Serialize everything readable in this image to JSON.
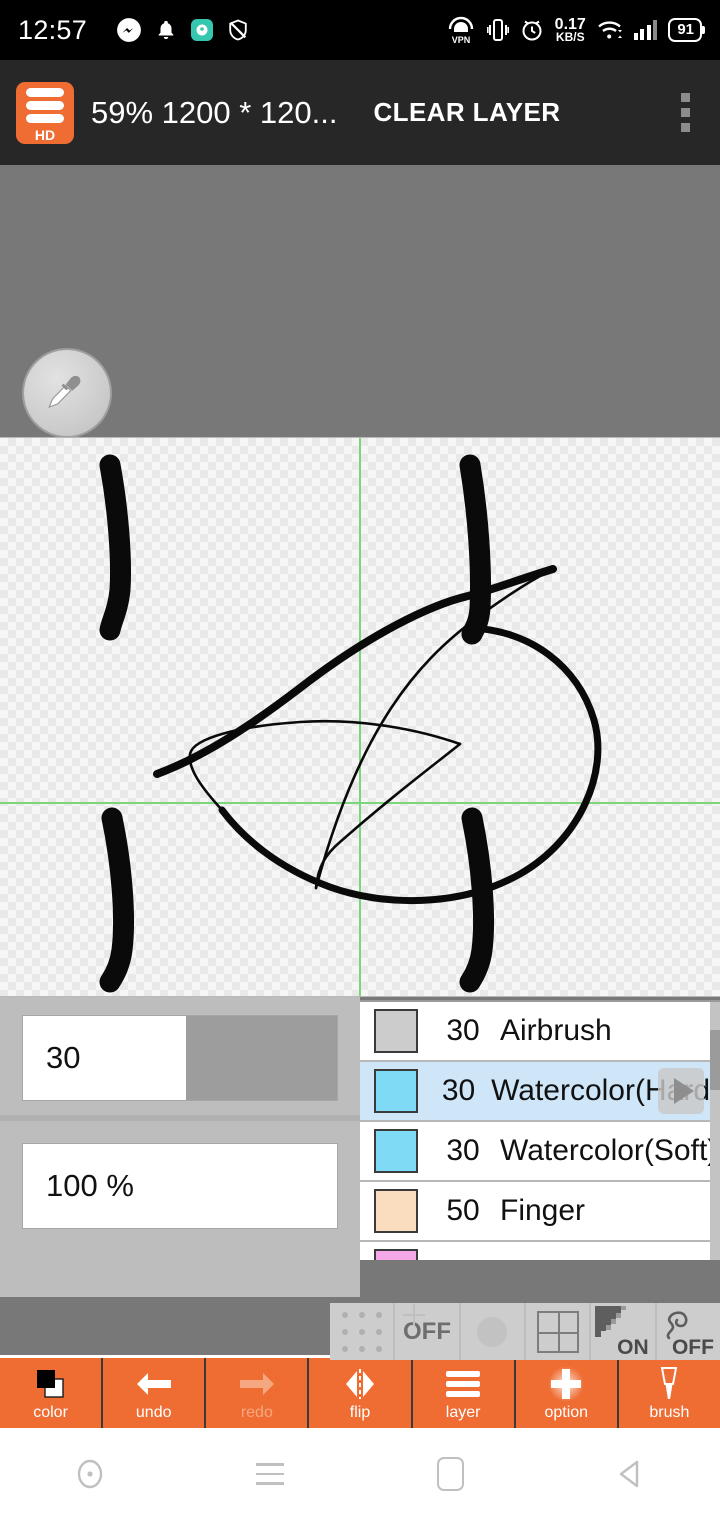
{
  "statusbar": {
    "time": "12:57",
    "left_icons": [
      "messenger-icon",
      "bell-icon",
      "app-badge-icon",
      "shield-icon"
    ],
    "vpn_label": "VPN",
    "netspeed_value": "0.17",
    "netspeed_unit": "KB/S",
    "battery": "91",
    "right_icons": [
      "vpn-icon",
      "vibrate-icon",
      "alarm-icon",
      "network-speed",
      "wifi-icon",
      "signal-icon",
      "battery-icon"
    ]
  },
  "appbar": {
    "logo_label": "HD",
    "doc_title": "59% 1200 * 120...",
    "clear_layer_label": "CLEAR LAYER",
    "overflow_icon": "kebab-menu-icon"
  },
  "workspace": {
    "eyedropper_icon": "eyedropper-icon",
    "canvas": {
      "guides": "green-crosshair-guides",
      "background": "transparency-checkerboard"
    }
  },
  "params": {
    "brush_size_value": "30",
    "brush_size_fill_percent": 52,
    "opacity_value": "100 %"
  },
  "brushes": {
    "items": [
      {
        "size": "30",
        "name": "Airbrush",
        "color": "#cccccc",
        "selected": false
      },
      {
        "size": "30",
        "name": "Watercolor(Hard)",
        "color": "#7fdbf5",
        "selected": true
      },
      {
        "size": "30",
        "name": "Watercolor(Soft)",
        "color": "#7fdbf5",
        "selected": false
      },
      {
        "size": "50",
        "name": "Finger",
        "color": "#fadcbe",
        "selected": false
      },
      {
        "size": "",
        "name": "",
        "color": "#f4a8e8",
        "selected": false
      }
    ],
    "preview_overlay_icon": "play-triangle-icon",
    "scrollbar": "vertical-scrollbar"
  },
  "option_bar": {
    "items": [
      {
        "icon": "dot-grid-icon",
        "label": ""
      },
      {
        "icon": "crosshair-icon",
        "label": "OFF"
      },
      {
        "icon": "circle-icon",
        "label": ""
      },
      {
        "icon": "grid-2x2-icon",
        "label": ""
      },
      {
        "icon": "antialias-icon",
        "label": "ON"
      },
      {
        "icon": "stabilizer-squiggle-icon",
        "label": "OFF"
      }
    ]
  },
  "toolbar": {
    "items": [
      {
        "label": "color",
        "icon": "color-swatch-icon",
        "disabled": false
      },
      {
        "label": "undo",
        "icon": "arrow-left-icon",
        "disabled": false
      },
      {
        "label": "redo",
        "icon": "arrow-right-icon",
        "disabled": true
      },
      {
        "label": "flip",
        "icon": "flip-horizontal-icon",
        "disabled": false
      },
      {
        "label": "layer",
        "icon": "layers-icon",
        "disabled": false
      },
      {
        "label": "option",
        "icon": "plus-icon",
        "disabled": false
      },
      {
        "label": "brush",
        "icon": "brush-icon",
        "disabled": false
      }
    ]
  },
  "navbar": {
    "items": [
      "assistant-icon",
      "recents-menu-icon",
      "home-icon",
      "back-icon"
    ]
  },
  "colors": {
    "accent": "#ef6c33",
    "appbar_bg": "#272727",
    "workspace_bg": "#787878",
    "guide_green": "#7bd67b",
    "selected_row": "#cfe6f8"
  }
}
